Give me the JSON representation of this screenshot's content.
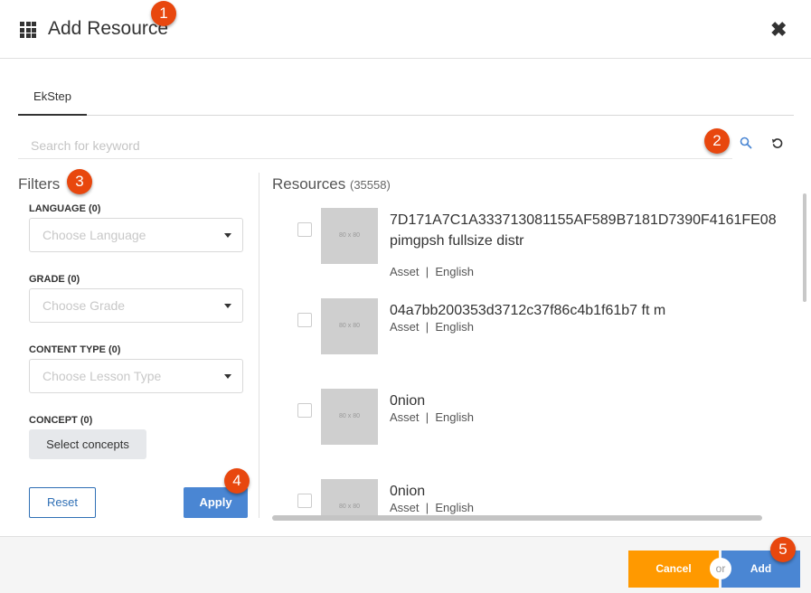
{
  "header": {
    "title": "Add Resource",
    "grid_icon": "grid-icon",
    "close_icon": "close-icon",
    "close_glyph": "✖"
  },
  "annotations": [
    "1",
    "2",
    "3",
    "4",
    "5"
  ],
  "tabs": [
    {
      "label": "EkStep",
      "active": true
    }
  ],
  "search": {
    "placeholder": "Search for keyword",
    "value": "",
    "search_icon": "search-icon",
    "refresh_icon": "refresh-icon"
  },
  "filters": {
    "title": "Filters",
    "language": {
      "label": "LANGUAGE (0)",
      "placeholder": "Choose Language"
    },
    "grade": {
      "label": "GRADE (0)",
      "placeholder": "Choose Grade"
    },
    "content_type": {
      "label": "CONTENT TYPE (0)",
      "placeholder": "Choose Lesson Type"
    },
    "concept": {
      "label": "CONCEPT (0)",
      "button": "Select concepts"
    },
    "reset": "Reset",
    "apply": "Apply"
  },
  "resources": {
    "title": "Resources",
    "count": "(35558)",
    "thumb_label": "80 x 80",
    "items": [
      {
        "name": "7D171A7C1A333713081155AF589B7181D7390F4161FE08 pimgpsh fullsize distr",
        "type": "Asset",
        "sep": "|",
        "language": "English",
        "checked": false
      },
      {
        "name": "04a7bb200353d3712c37f86c4b1f61b7 ft m",
        "type": "Asset",
        "sep": "|",
        "language": "English",
        "checked": false
      },
      {
        "name": "0nion",
        "type": "Asset",
        "sep": "|",
        "language": "English",
        "checked": false
      },
      {
        "name": "0nion",
        "type": "Asset",
        "sep": "|",
        "language": "English",
        "checked": false
      }
    ]
  },
  "footer": {
    "cancel": "Cancel",
    "or": "or",
    "add": "Add"
  },
  "colors": {
    "badge": "#e8470e",
    "primary": "#4a86d3",
    "cancel": "#ff9900"
  }
}
